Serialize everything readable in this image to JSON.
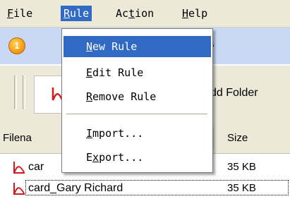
{
  "menubar": {
    "file": {
      "key": "F",
      "rest": "ile"
    },
    "rule": {
      "key": "R",
      "rest": "ule"
    },
    "action": {
      "pre": "Ac",
      "key": "t",
      "rest": "ion"
    },
    "help": {
      "key": "H",
      "rest": "elp"
    }
  },
  "banner": {
    "badge": "1",
    "partial_text": "s"
  },
  "toolbar": {
    "add_folder": {
      "pre": "Add F",
      "key": "o",
      "rest": "lder",
      "visible": "dd Folder"
    }
  },
  "list": {
    "columns": {
      "filename": "Filena",
      "size": "Size"
    },
    "rows": [
      {
        "name": "car",
        "size": "35 KB"
      },
      {
        "name": "card_Gary Richard",
        "size": "35 KB"
      }
    ]
  },
  "rule_menu": {
    "items": [
      {
        "key": "N",
        "rest": "ew Rule"
      },
      {
        "key": "E",
        "rest": "dit Rule"
      },
      {
        "key": "R",
        "rest": "emove Rule"
      },
      {
        "key": "I",
        "rest": "mport..."
      },
      {
        "key": "x",
        "pre": "E",
        "rest": "port..."
      }
    ]
  },
  "colors": {
    "selection": "#316ac5",
    "menubar": "#ece9d8",
    "banner": "#c9d9f5",
    "pdf_icon": "#d31b1b"
  }
}
